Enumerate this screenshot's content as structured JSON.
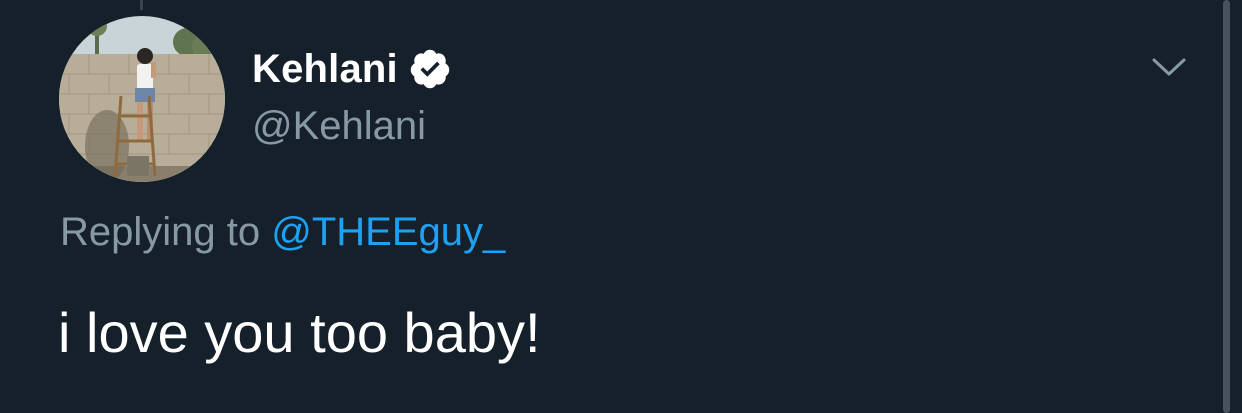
{
  "author": {
    "display_name": "Kehlani",
    "handle": "@Kehlani",
    "verified": true,
    "verified_icon": "verified-badge-icon",
    "avatar_description_icon": "avatar-photo"
  },
  "reply": {
    "prefix": "Replying to",
    "mention": "@THEEguy_"
  },
  "tweet": {
    "text": "i love you too baby!"
  },
  "menu": {
    "icon": "chevron-down-icon"
  },
  "colors": {
    "background": "#15202b",
    "primary_text": "#ffffff",
    "secondary_text": "#8899a6",
    "link": "#1da1f2"
  }
}
